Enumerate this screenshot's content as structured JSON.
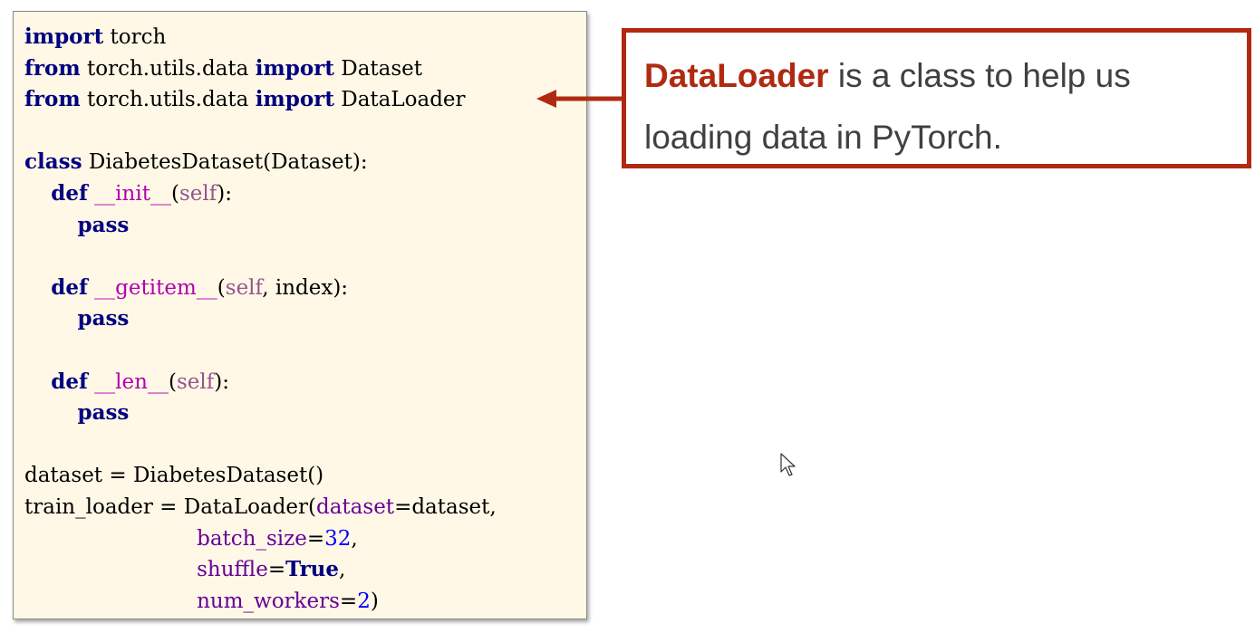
{
  "code": {
    "lines": [
      [
        {
          "t": "import",
          "c": "kw"
        },
        {
          "t": " torch",
          "c": "plain"
        }
      ],
      [
        {
          "t": "from",
          "c": "kw"
        },
        {
          "t": " torch.utils.data ",
          "c": "plain"
        },
        {
          "t": "import",
          "c": "kw"
        },
        {
          "t": " Dataset",
          "c": "plain"
        }
      ],
      [
        {
          "t": "from",
          "c": "kw"
        },
        {
          "t": " torch.utils.data ",
          "c": "plain"
        },
        {
          "t": "import",
          "c": "kw"
        },
        {
          "t": " DataLoader",
          "c": "plain"
        }
      ],
      [],
      [
        {
          "t": "class",
          "c": "kw"
        },
        {
          "t": " DiabetesDataset(Dataset):",
          "c": "plain"
        }
      ],
      [
        {
          "t": "    ",
          "c": "plain"
        },
        {
          "t": "def",
          "c": "kw"
        },
        {
          "t": " ",
          "c": "plain"
        },
        {
          "t": "__init__",
          "c": "fn"
        },
        {
          "t": "(",
          "c": "plain"
        },
        {
          "t": "self",
          "c": "slf"
        },
        {
          "t": "):",
          "c": "plain"
        }
      ],
      [
        {
          "t": "        ",
          "c": "plain"
        },
        {
          "t": "pass",
          "c": "kw"
        }
      ],
      [],
      [
        {
          "t": "    ",
          "c": "plain"
        },
        {
          "t": "def",
          "c": "kw"
        },
        {
          "t": " ",
          "c": "plain"
        },
        {
          "t": "__getitem__",
          "c": "fn"
        },
        {
          "t": "(",
          "c": "plain"
        },
        {
          "t": "self",
          "c": "slf"
        },
        {
          "t": ", index):",
          "c": "plain"
        }
      ],
      [
        {
          "t": "        ",
          "c": "plain"
        },
        {
          "t": "pass",
          "c": "kw"
        }
      ],
      [],
      [
        {
          "t": "    ",
          "c": "plain"
        },
        {
          "t": "def",
          "c": "kw"
        },
        {
          "t": " ",
          "c": "plain"
        },
        {
          "t": "__len__",
          "c": "fn"
        },
        {
          "t": "(",
          "c": "plain"
        },
        {
          "t": "self",
          "c": "slf"
        },
        {
          "t": "):",
          "c": "plain"
        }
      ],
      [
        {
          "t": "        ",
          "c": "plain"
        },
        {
          "t": "pass",
          "c": "kw"
        }
      ],
      [],
      [
        {
          "t": "dataset = DiabetesDataset()",
          "c": "plain"
        }
      ],
      [
        {
          "t": "train_loader = DataLoader(",
          "c": "plain"
        },
        {
          "t": "dataset",
          "c": "kwarg"
        },
        {
          "t": "=dataset,",
          "c": "plain"
        }
      ],
      [
        {
          "t": "                          ",
          "c": "plain"
        },
        {
          "t": "batch_size",
          "c": "kwarg"
        },
        {
          "t": "=",
          "c": "plain"
        },
        {
          "t": "32",
          "c": "num"
        },
        {
          "t": ",",
          "c": "plain"
        }
      ],
      [
        {
          "t": "                          ",
          "c": "plain"
        },
        {
          "t": "shuffle",
          "c": "kwarg"
        },
        {
          "t": "=",
          "c": "plain"
        },
        {
          "t": "True",
          "c": "kw"
        },
        {
          "t": ",",
          "c": "plain"
        }
      ],
      [
        {
          "t": "                          ",
          "c": "plain"
        },
        {
          "t": "num_workers",
          "c": "kwarg"
        },
        {
          "t": "=",
          "c": "plain"
        },
        {
          "t": "2",
          "c": "num"
        },
        {
          "t": ")",
          "c": "plain"
        }
      ]
    ]
  },
  "callout": {
    "highlight": "DataLoader",
    "text": " is a class to help us loading data in PyTorch."
  },
  "colors": {
    "accent": "#b02a12",
    "code_background": "#fff8e6",
    "keyword": "#000080",
    "kwarg": "#660099",
    "number": "#0000ff",
    "self": "#94558d"
  },
  "icons": {
    "arrow": "arrow-left-icon",
    "cursor": "mouse-cursor-icon"
  }
}
